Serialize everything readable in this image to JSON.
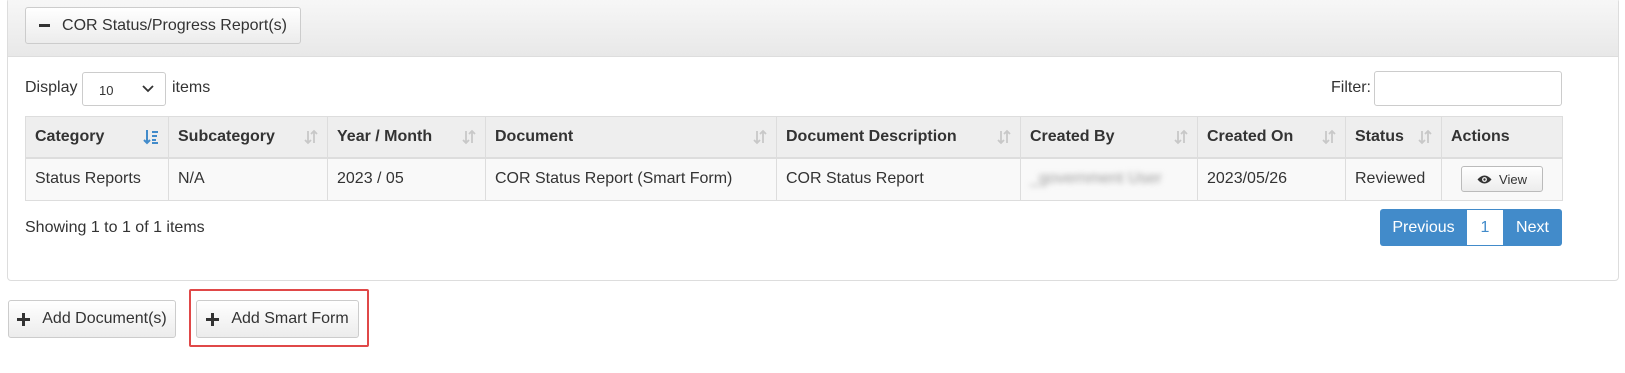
{
  "panel": {
    "collapse_button_label": "COR Status/Progress Report(s)"
  },
  "length_menu": {
    "display_label": "Display",
    "selected_value": "10",
    "items_label": "items"
  },
  "filter": {
    "label": "Filter:",
    "value": "",
    "placeholder": ""
  },
  "table": {
    "columns": [
      "Category",
      "Subcategory",
      "Year / Month",
      "Document",
      "Document Description",
      "Created By",
      "Created On",
      "Status",
      "Actions"
    ],
    "sorted_column": "Category",
    "rows": [
      {
        "category": "Status Reports",
        "subcategory": "N/A",
        "year_month": "2023 / 05",
        "document": "COR Status Report (Smart Form)",
        "description": "COR Status Report",
        "created_by": "_government User",
        "created_on": "2023/05/26",
        "status": "Reviewed",
        "action_label": "View"
      }
    ]
  },
  "footer": {
    "showing_text": "Showing 1 to 1 of 1 items"
  },
  "pagination": {
    "previous": "Previous",
    "current_page": "1",
    "next": "Next"
  },
  "bottom_actions": {
    "add_document": "Add Document(s)",
    "add_smart_form": "Add Smart Form"
  },
  "colors": {
    "primary": "#428bca",
    "highlight": "#e04848",
    "header_bg": "#eeeeee"
  }
}
